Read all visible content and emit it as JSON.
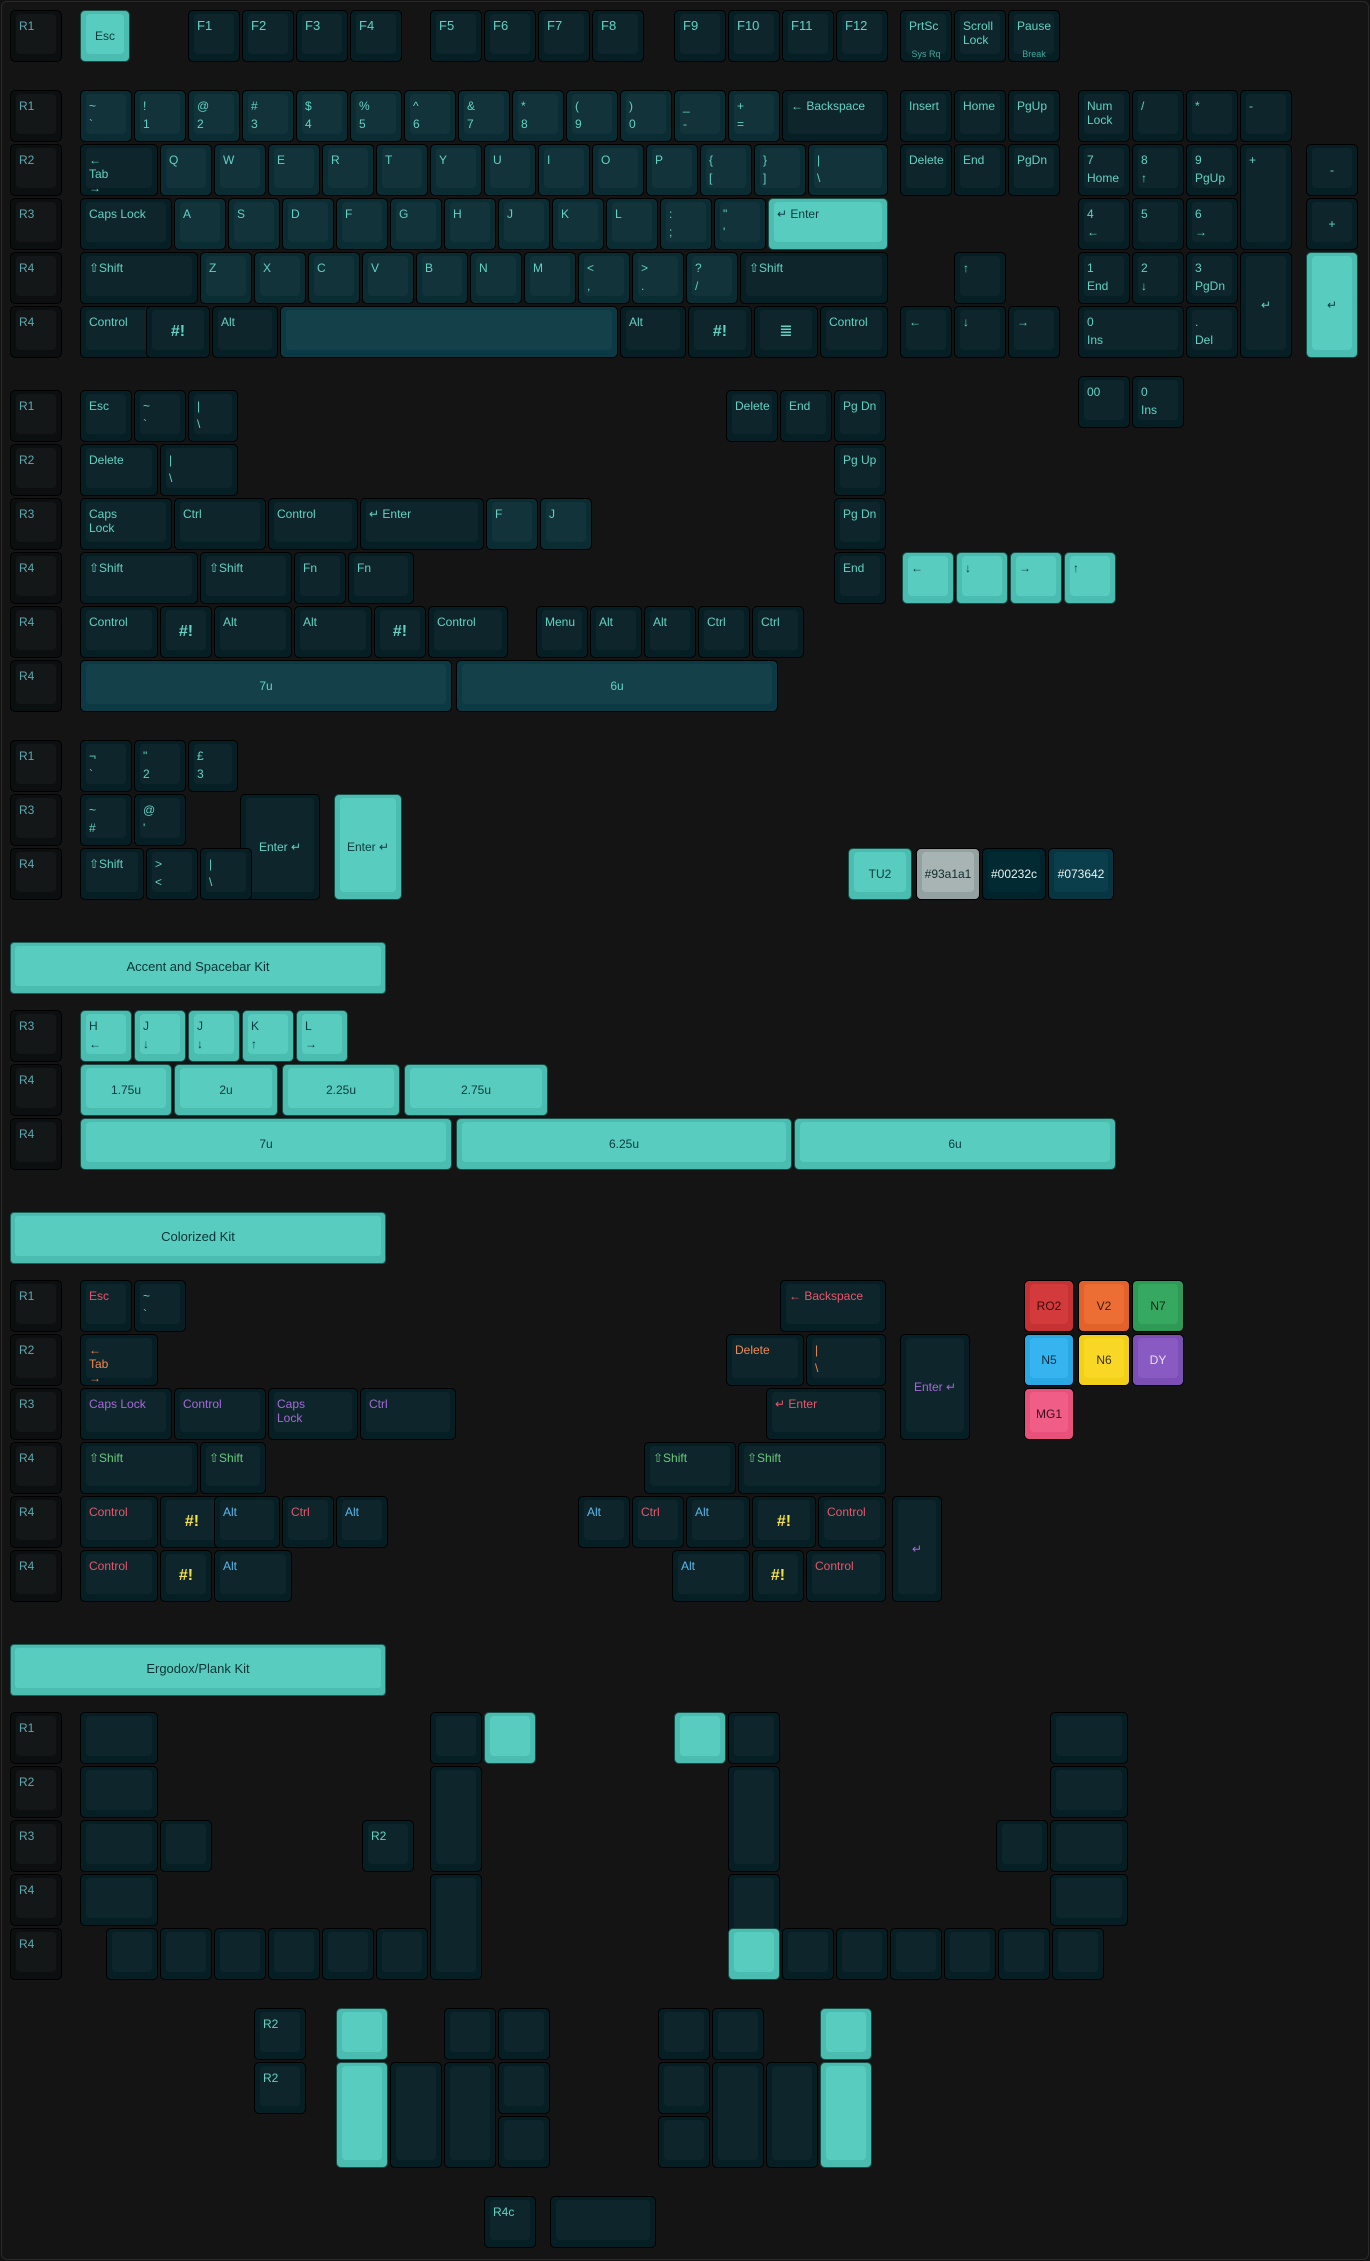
{
  "sections": {
    "accent_kit": "Accent and Spacebar Kit",
    "colorized_kit": "Colorized Kit",
    "ergo_kit": "Ergodox/Plank Kit"
  },
  "swatches": [
    "TU2",
    "#93a1a1",
    "#00232c",
    "#073642"
  ],
  "colorized_codes": [
    "RO2",
    "V2",
    "N7",
    "N5",
    "N6",
    "DY",
    "MG1"
  ],
  "legends": {
    "f_row": [
      "Esc",
      "F1",
      "F2",
      "F3",
      "F4",
      "F5",
      "F6",
      "F7",
      "F8",
      "F9",
      "F10",
      "F11",
      "F12",
      "PrtSc",
      "Sys Rq",
      "Scroll\nLock",
      "Pause",
      "Break"
    ],
    "num_row": [
      "~",
      "`",
      "!",
      "1",
      "@",
      "2",
      "#",
      "3",
      "$",
      "4",
      "%",
      "5",
      "^",
      "6",
      "&",
      "7",
      "*",
      "8",
      "(",
      "9",
      ")",
      "0",
      "_",
      "-",
      "+",
      "=",
      "← Backspace"
    ],
    "nav": [
      "Insert",
      "Home",
      "PgUp",
      "Delete",
      "End",
      "PgDn"
    ],
    "numpad": [
      "Num\nLock",
      "/",
      "*",
      "-",
      "7",
      "Home",
      "8",
      "↑",
      "9",
      "PgUp",
      "+",
      "4",
      "←",
      "5",
      "6",
      "→",
      "1",
      "End",
      "2",
      "↓",
      "3",
      "PgDn",
      "0",
      "Ins",
      ".",
      "Del",
      "00",
      "↵"
    ],
    "alpha_row2": [
      "←\nTab\n→",
      "Q",
      "W",
      "E",
      "R",
      "T",
      "Y",
      "U",
      "I",
      "O",
      "P",
      "{",
      "[",
      "}",
      "]",
      "|",
      "\\"
    ],
    "alpha_row3": [
      "Caps Lock",
      "A",
      "S",
      "D",
      "F",
      "G",
      "H",
      "J",
      "K",
      "L",
      ":",
      ";",
      "\"",
      "'",
      "↵ Enter"
    ],
    "alpha_row4": [
      "⇧Shift",
      "Z",
      "X",
      "C",
      "V",
      "B",
      "N",
      "M",
      "<",
      ",",
      ">",
      ".",
      "?",
      "/",
      "⇧Shift"
    ],
    "bottom_row": [
      "Control",
      "#!",
      "Alt",
      "Alt",
      "#!",
      "≣",
      "Control"
    ],
    "arrows": [
      "↑",
      "←",
      "↓",
      "→"
    ],
    "mods": [
      "Esc",
      "~",
      "`",
      "|",
      "\\",
      "Delete",
      "End",
      "Pg Dn",
      "Pg Up",
      "Caps\nLock",
      "Ctrl",
      "Control",
      "↵ Enter",
      "F",
      "J",
      "⇧Shift",
      "Fn",
      "Menu",
      "Alt",
      "Ctrl",
      "7u",
      "6u"
    ],
    "iso": [
      "¬",
      "`",
      "\"",
      "2",
      "£",
      "3",
      "~",
      "#",
      "@",
      "'",
      "Enter ↵",
      "⇧Shift",
      ">",
      "<",
      "|",
      "\\"
    ],
    "accent": [
      "H",
      "←",
      "J",
      "↓",
      "K",
      "↑",
      "L",
      "→",
      "1.75u",
      "2u",
      "2.25u",
      "2.75u",
      "7u",
      "6.25u",
      "6u"
    ],
    "colorized": [
      "Esc",
      "~",
      "`",
      "← Backspace",
      "←\nTab\n→",
      "Delete",
      "|",
      "\\",
      "Enter ↵",
      "Caps Lock",
      "Control",
      "Caps\nLock",
      "Ctrl",
      "↵ Enter",
      "⇧Shift",
      "Control",
      "#!",
      "Alt",
      "Ctrl",
      "↵"
    ],
    "ergo": [
      "R2",
      "R4c"
    ]
  },
  "rows": [
    "R1",
    "R2",
    "R3",
    "R4",
    "R4c"
  ]
}
